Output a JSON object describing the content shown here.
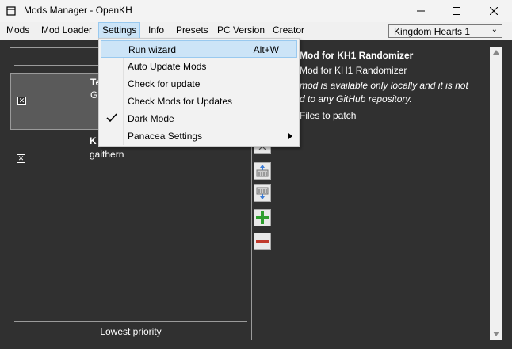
{
  "window": {
    "title": "Mods Manager - OpenKH"
  },
  "menubar": {
    "items": [
      "Mods",
      "Mod Loader",
      "Settings",
      "Info",
      "Presets",
      "PC Version",
      "Creator"
    ],
    "active_index": 2,
    "game_select": "Kingdom Hearts 1"
  },
  "settings_menu": {
    "items": [
      {
        "label": "Run wizard",
        "shortcut": "Alt+W",
        "highlighted": true
      },
      {
        "label": "Auto Update Mods"
      },
      {
        "label": "Check for update"
      },
      {
        "label": "Check Mods for Updates"
      },
      {
        "label": "Dark Mode",
        "checked": true
      },
      {
        "label": "Panacea Settings",
        "submenu": true
      }
    ]
  },
  "mod_list": {
    "items": [
      {
        "title": "Te",
        "author": "G",
        "checked": true,
        "selected": true
      },
      {
        "title": "K",
        "author": "gaithern",
        "checked": true
      }
    ],
    "footer": "Lowest priority"
  },
  "details": {
    "title": "Mod for KH1 Randomizer",
    "subtitle": "Mod for KH1 Randomizer",
    "description": "mod is available only locally and it is not\nd to any GitHub repository.",
    "files_label": "Files to patch"
  },
  "icons": [
    "app-icon",
    "minimize-icon",
    "maximize-icon",
    "close-icon",
    "move-up-icon",
    "export-icon",
    "import-icon",
    "add-icon",
    "remove-icon",
    "checkmark-icon",
    "submenu-arrow-icon",
    "dropdown-chevron-icon"
  ],
  "colors": {
    "accent": "#cce4f7",
    "add": "#2e9e2e",
    "remove": "#c0392b",
    "dark_bg": "#303030"
  }
}
